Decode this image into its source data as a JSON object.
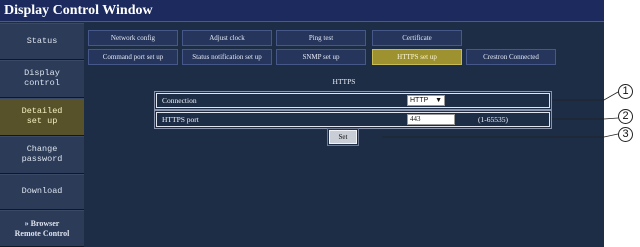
{
  "window": {
    "title": "Display Control Window"
  },
  "sidebar": {
    "items": [
      {
        "label": "Status"
      },
      {
        "label": "Display\ncontrol"
      },
      {
        "label": "Detailed\nset up",
        "active": true
      },
      {
        "label": "Change\npassword"
      },
      {
        "label": "Download"
      },
      {
        "label": "» Browser\nRemote Control"
      }
    ]
  },
  "tabs": {
    "row1": [
      "Network config",
      "Adjust clock",
      "Ping test",
      "Certificate"
    ],
    "row2": [
      "Command port set up",
      "Status notification set up",
      "SNMP set up",
      "HTTPS set up",
      "Crestron Connected"
    ],
    "active": "HTTPS set up"
  },
  "https": {
    "section_title": "HTTPS",
    "connection_label": "Connection",
    "connection_value": "HTTP",
    "port_label": "HTTPS port",
    "port_value": "443",
    "port_range": "(1-65535)",
    "set_label": "Set"
  },
  "callouts": [
    "1",
    "2",
    "3"
  ],
  "colors": {
    "active_tab": "#9e9230",
    "active_sidebar": "#57522a",
    "background": "#1e2d46"
  }
}
